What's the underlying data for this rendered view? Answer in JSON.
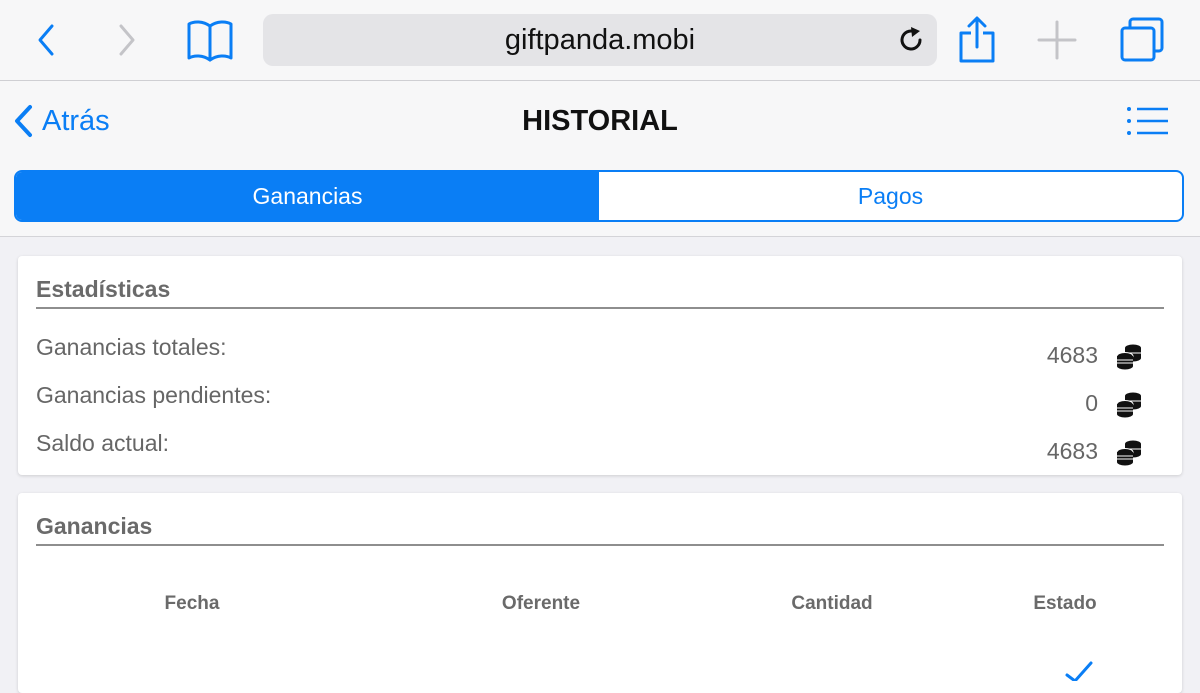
{
  "browser": {
    "url": "giftpanda.mobi",
    "icons": {
      "back": "chevron-left-icon",
      "forward": "chevron-right-icon",
      "bookmarks": "book-icon",
      "reload": "reload-icon",
      "share": "share-icon",
      "new_tab": "plus-icon",
      "tabs": "tabs-icon"
    }
  },
  "header": {
    "back_label": "Atrás",
    "title": "HISTORIAL",
    "menu_icon": "list-icon"
  },
  "segments": {
    "items": [
      {
        "label": "Ganancias",
        "active": true
      },
      {
        "label": "Pagos",
        "active": false
      }
    ]
  },
  "stats": {
    "title": "Estadísticas",
    "rows": [
      {
        "label": "Ganancias totales:",
        "value": "4683"
      },
      {
        "label": "Ganancias pendientes:",
        "value": "0"
      },
      {
        "label": "Saldo actual:",
        "value": "4683"
      }
    ],
    "coin_icon": "coins-icon"
  },
  "earnings": {
    "title": "Ganancias",
    "columns": [
      "Fecha",
      "Oferente",
      "Cantidad",
      "Estado"
    ]
  },
  "colors": {
    "accent": "#0a7ef5",
    "page_bg": "#f1f1f5",
    "toolbar_bg": "#f7f7f8"
  }
}
